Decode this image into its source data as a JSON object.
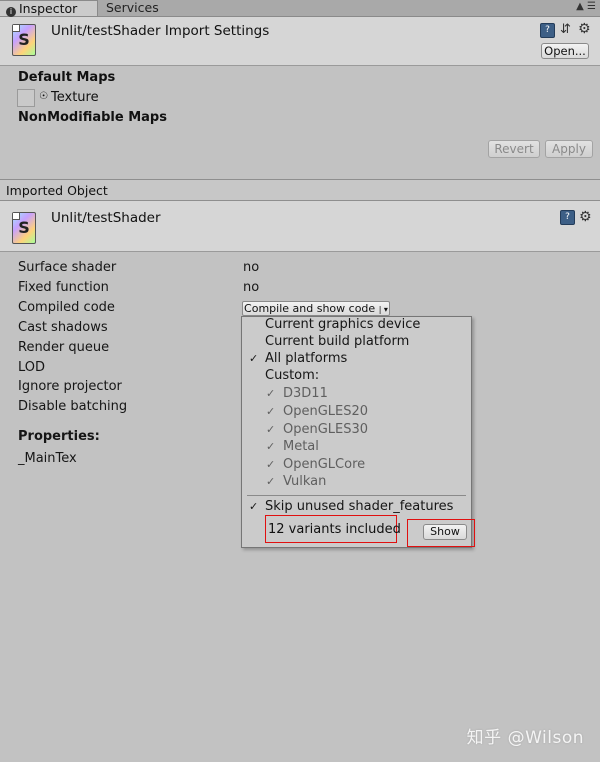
{
  "tabs": {
    "inspector": "Inspector",
    "services": "Services"
  },
  "import_settings": {
    "title": "Unlit/testShader Import Settings",
    "icon_letter": "S",
    "open_label": "Open...",
    "default_maps_label": "Default Maps",
    "texture_label": "Texture",
    "nonmodifiable_maps_label": "NonModifiable Maps",
    "revert_label": "Revert",
    "apply_label": "Apply"
  },
  "imported_object": {
    "section_label": "Imported Object",
    "title": "Unlit/testShader",
    "icon_letter": "S"
  },
  "properties": [
    {
      "label": "Surface shader",
      "value": "no"
    },
    {
      "label": "Fixed function",
      "value": "no"
    },
    {
      "label": "Compiled code",
      "value": ""
    },
    {
      "label": "Cast shadows",
      "value": ""
    },
    {
      "label": "Render queue",
      "value": ""
    },
    {
      "label": "LOD",
      "value": ""
    },
    {
      "label": "Ignore projector",
      "value": ""
    },
    {
      "label": "Disable batching",
      "value": ""
    }
  ],
  "compile_button_label": "Compile and show code",
  "properties_header": "Properties:",
  "maintex_label": "_MainTex",
  "dropdown": {
    "items": [
      {
        "label": "Current graphics device",
        "checked": ""
      },
      {
        "label": "Current build platform",
        "checked": ""
      },
      {
        "label": "All platforms",
        "checked": "✓"
      },
      {
        "label": "Custom:",
        "checked": ""
      },
      {
        "label": "D3D11",
        "checked": "✓"
      },
      {
        "label": "OpenGLES20",
        "checked": "✓"
      },
      {
        "label": "OpenGLES30",
        "checked": "✓"
      },
      {
        "label": "Metal",
        "checked": "✓"
      },
      {
        "label": "OpenGLCore",
        "checked": "✓"
      },
      {
        "label": "Vulkan",
        "checked": "✓"
      }
    ],
    "skip_label": "Skip unused shader_features",
    "skip_checked": "✓",
    "variants_label": "12 variants included",
    "show_label": "Show"
  },
  "watermark": "知乎 @Wilson",
  "colors": {
    "highlight": "#e01010",
    "panel": "#c2c2c2",
    "header": "#d6d6d6"
  }
}
